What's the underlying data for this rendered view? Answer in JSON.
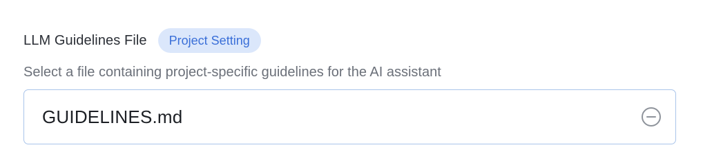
{
  "setting": {
    "label": "LLM Guidelines File",
    "badge": "Project Setting",
    "description": "Select a file containing project-specific guidelines for the AI assistant",
    "value": "GUIDELINES.md",
    "clear_icon": "minus-circle-icon"
  },
  "colors": {
    "badge_bg": "#dbe7fb",
    "badge_text": "#3a6fd8",
    "input_border": "#a9c4ea"
  }
}
